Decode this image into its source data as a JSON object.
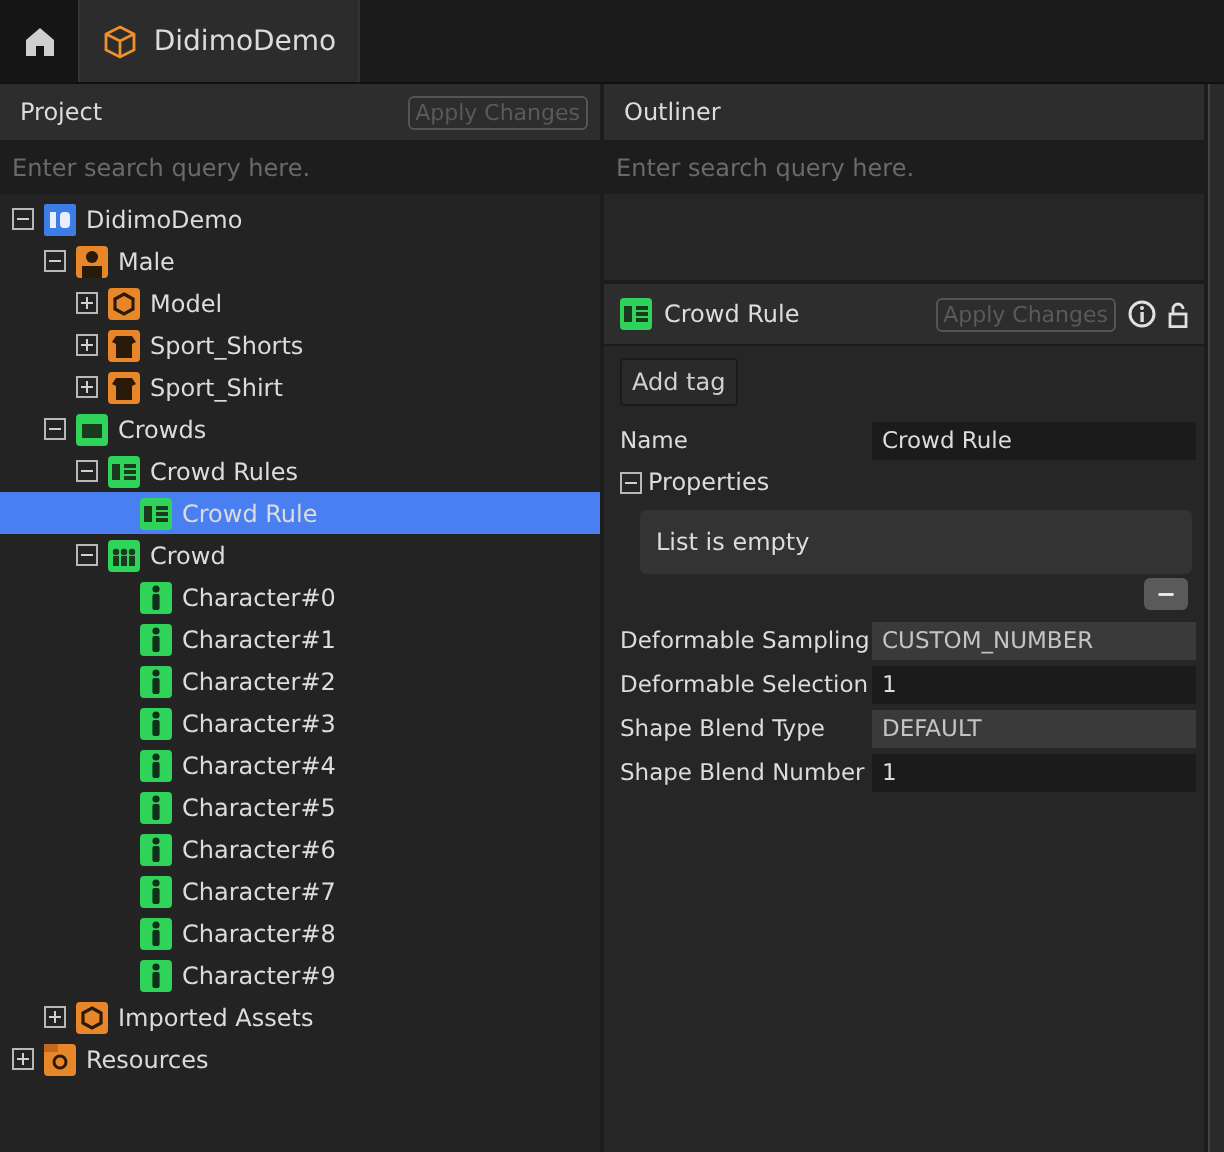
{
  "tabs": [
    {
      "kind": "home",
      "selected": false
    },
    {
      "kind": "project",
      "label": "DidimoDemo",
      "selected": true
    }
  ],
  "project_panel": {
    "title": "Project",
    "apply_button": {
      "label": "Apply Changes",
      "disabled": true
    },
    "search": {
      "placeholder": "Enter search query here."
    },
    "tree": [
      {
        "label": "DidimoDemo",
        "kind": "project",
        "expanded": true,
        "selected": false,
        "children": [
          {
            "label": "Male",
            "kind": "character",
            "expanded": true,
            "selected": false,
            "children": [
              {
                "label": "Model",
                "kind": "model",
                "expanded": false,
                "selected": false
              },
              {
                "label": "Sport_Shorts",
                "kind": "clothing",
                "expanded": false,
                "selected": false
              },
              {
                "label": "Sport_Shirt",
                "kind": "clothing",
                "expanded": false,
                "selected": false
              }
            ]
          },
          {
            "label": "Crowds",
            "kind": "crowds",
            "expanded": true,
            "selected": false,
            "children": [
              {
                "label": "Crowd Rules",
                "kind": "rules",
                "expanded": true,
                "selected": false,
                "children": [
                  {
                    "label": "Crowd Rule",
                    "kind": "rule",
                    "selected": true
                  }
                ]
              },
              {
                "label": "Crowd",
                "kind": "crowd",
                "expanded": true,
                "selected": false,
                "children": [
                  {
                    "label": "Character#0",
                    "kind": "agent",
                    "selected": false
                  },
                  {
                    "label": "Character#1",
                    "kind": "agent",
                    "selected": false
                  },
                  {
                    "label": "Character#2",
                    "kind": "agent",
                    "selected": false
                  },
                  {
                    "label": "Character#3",
                    "kind": "agent",
                    "selected": false
                  },
                  {
                    "label": "Character#4",
                    "kind": "agent",
                    "selected": false
                  },
                  {
                    "label": "Character#5",
                    "kind": "agent",
                    "selected": false
                  },
                  {
                    "label": "Character#6",
                    "kind": "agent",
                    "selected": false
                  },
                  {
                    "label": "Character#7",
                    "kind": "agent",
                    "selected": false
                  },
                  {
                    "label": "Character#8",
                    "kind": "agent",
                    "selected": false
                  },
                  {
                    "label": "Character#9",
                    "kind": "agent",
                    "selected": false
                  }
                ]
              }
            ]
          },
          {
            "label": "Imported Assets",
            "kind": "assets",
            "expanded": false,
            "selected": false
          }
        ]
      },
      {
        "label": "Resources",
        "kind": "resources",
        "expanded": false,
        "selected": false
      }
    ]
  },
  "outliner_panel": {
    "title": "Outliner",
    "search": {
      "placeholder": "Enter search query here."
    }
  },
  "inspector": {
    "title": "Crowd Rule",
    "kind": "rule",
    "apply_button": {
      "label": "Apply Changes",
      "disabled": true
    },
    "add_tag_button": "Add tag",
    "name_row": {
      "label": "Name",
      "value": "Crowd Rule"
    },
    "properties": {
      "label": "Properties",
      "expanded": true,
      "empty_text": "List is empty",
      "remove_button": "−"
    },
    "fields": [
      {
        "label": "Deformable Sampling",
        "value": "CUSTOM_NUMBER",
        "kind": "readonly"
      },
      {
        "label": "Deformable Selection",
        "value": "1",
        "kind": "input"
      },
      {
        "label": "Shape Blend Type",
        "value": "DEFAULT",
        "kind": "readonly"
      },
      {
        "label": "Shape Blend Number",
        "value": "1",
        "kind": "input"
      }
    ]
  }
}
